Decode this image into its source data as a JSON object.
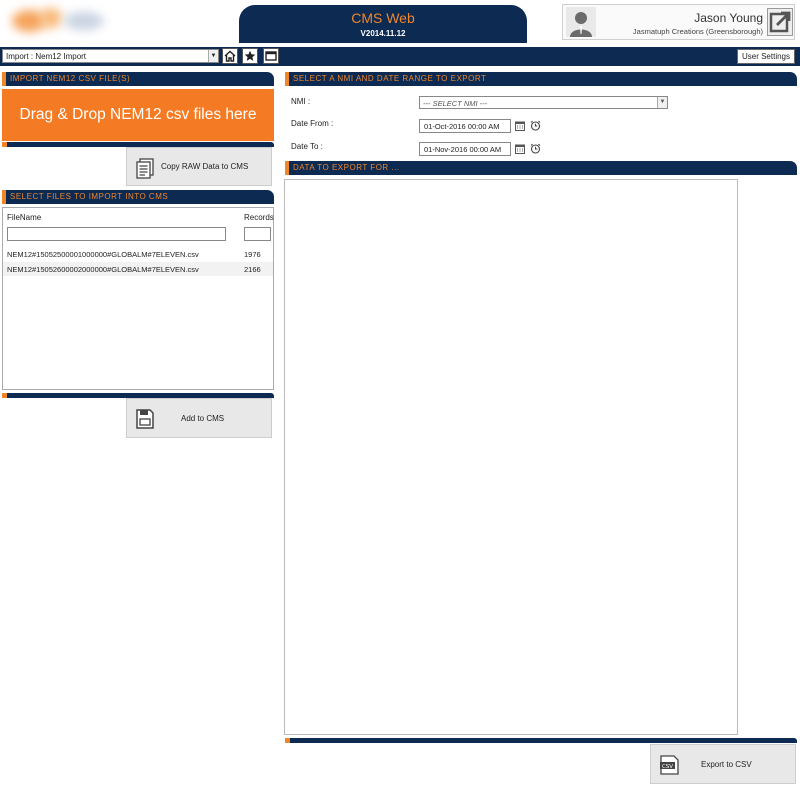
{
  "header": {
    "app_title": "CMS Web",
    "version": "V2014.11.12",
    "user_name": "Jason Young",
    "user_org": "Jasmatuph Creations (Greensborough)"
  },
  "navbar": {
    "page_select_value": "Import : Nem12 Import",
    "icons": [
      "home-icon",
      "star-icon",
      "window-icon"
    ],
    "user_settings_label": "User Settings"
  },
  "import_panel": {
    "header": "IMPORT NEM12 CSV FILE(S)",
    "dropzone_text": "Drag & Drop NEM12 csv files here",
    "copy_button_label": "Copy RAW Data to CMS"
  },
  "files_panel": {
    "header": "SELECT FILES TO IMPORT INTO CMS",
    "columns": [
      "FileName",
      "Records"
    ],
    "rows": [
      {
        "filename": "NEM12#15052500001000000#GLOBALM#7ELEVEN.csv",
        "records": "1976"
      },
      {
        "filename": "NEM12#15052600002000000#GLOBALM#7ELEVEN.csv",
        "records": "2166"
      }
    ],
    "add_button_label": "Add to CMS"
  },
  "export_panel": {
    "header": "SELECT A NMI AND DATE RANGE TO EXPORT",
    "nmi_label": "NMI :",
    "nmi_value": "--- SELECT NMI ---",
    "date_from_label": "Date From :",
    "date_from_value": "01-Oct-2016 00:00 AM",
    "date_to_label": "Date To :",
    "date_to_value": "01-Nov-2016 00:00 AM",
    "data_header": "DATA TO EXPORT FOR ...",
    "export_button_label": "Export to CSV",
    "export_icon_text": "CSV"
  },
  "colors": {
    "navy": "#0d2a52",
    "orange": "#f47b23",
    "accent_orange": "#f0862a"
  }
}
